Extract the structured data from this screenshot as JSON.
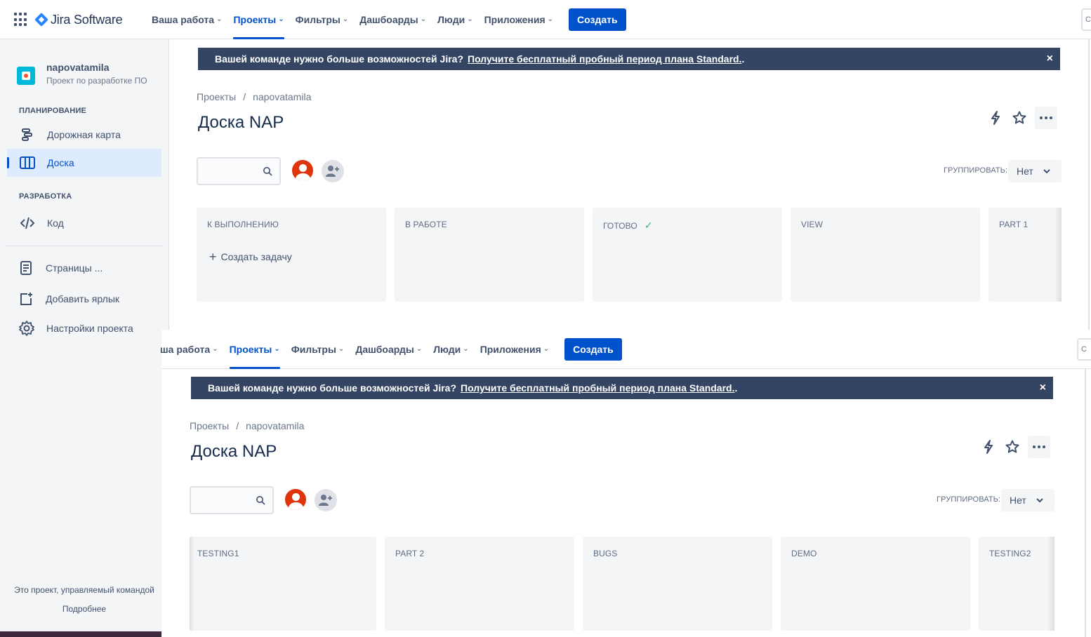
{
  "topnav": {
    "product": "Jira Software",
    "items": [
      {
        "label": "Ваша работа"
      },
      {
        "label": "Проекты",
        "active": true
      },
      {
        "label": "Фильтры"
      },
      {
        "label": "Дашбоарды"
      },
      {
        "label": "Люди"
      },
      {
        "label": "Приложения"
      }
    ],
    "create_label": "Создать",
    "search_stub": "С"
  },
  "topnav2": {
    "items": [
      {
        "label": "ша работа"
      },
      {
        "label": "Проекты",
        "active": true
      },
      {
        "label": "Фильтры"
      },
      {
        "label": "Дашбоарды"
      },
      {
        "label": "Люди"
      },
      {
        "label": "Приложения"
      }
    ],
    "create_label": "Создать",
    "search_stub": "С"
  },
  "sidebar": {
    "project_name": "napovatamila",
    "project_type": "Проект по разработке ПО",
    "section_planning": "ПЛАНИРОВАНИЕ",
    "roadmap": "Дорожная карта",
    "board": "Доска",
    "section_dev": "РАЗРАБОТКА",
    "code": "Код",
    "pages": "Страницы ...",
    "add_shortcut": "Добавить ярлык",
    "settings": "Настройки проекта",
    "footer_text": "Это проект, управляемый командой",
    "footer_link": "Подробнее"
  },
  "banner": {
    "text": "Вашей команде нужно больше возможностей Jira?",
    "link": "Получите бесплатный пробный период плана Standard.",
    "suffix": ".",
    "close": "×"
  },
  "board": {
    "breadcrumb_root": "Проекты",
    "breadcrumb_sep": "/",
    "breadcrumb_project": "napovatamila",
    "title": "Доска NAP",
    "group_label": "ГРУППИРОВАТЬ:",
    "group_value": "Нет",
    "create_task": "Создать задачу",
    "columns_top": [
      "К ВЫПОЛНЕНИЮ",
      "В РАБОТЕ",
      "ГОТОВО",
      "VIEW",
      "PART 1"
    ],
    "columns_bottom": [
      "TESTING1",
      "PART 2",
      "BUGS",
      "DEMO",
      "TESTING2"
    ]
  },
  "colors": {
    "accent": "#0052cc",
    "banner_bg": "#344563",
    "sidebar_bg": "#f4f5f7",
    "avatar": "#de350b",
    "done_check": "#36b37e"
  },
  "icons": [
    "apps-grid-icon",
    "jira-logo-icon",
    "chevron-down-icon",
    "project-avatar-icon",
    "roadmap-icon",
    "board-icon",
    "code-icon",
    "pages-icon",
    "add-shortcut-icon",
    "gear-icon",
    "close-icon",
    "lightning-icon",
    "star-icon",
    "more-icon",
    "search-icon",
    "user-avatar-icon",
    "add-person-icon",
    "check-icon",
    "plus-icon"
  ]
}
